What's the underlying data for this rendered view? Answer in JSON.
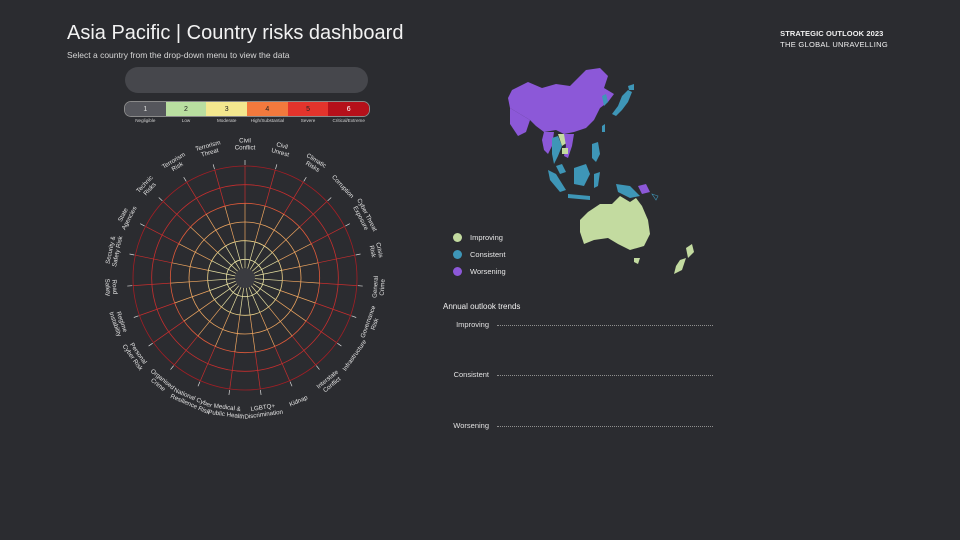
{
  "header": {
    "title": "Asia Pacific | Country risks dashboard",
    "subtitle": "Select a country from the drop-down menu to view the data",
    "brand_line1": "STRATEGIC OUTLOOK 2023",
    "brand_line2": "THE GLOBAL UNRAVELLING"
  },
  "dropdown": {
    "value": ""
  },
  "risk_scale": [
    {
      "num": "1",
      "label": "Negligible",
      "color": "#55565c"
    },
    {
      "num": "2",
      "label": "Low",
      "color": "#b9dea0"
    },
    {
      "num": "3",
      "label": "Moderate",
      "color": "#f3e78e"
    },
    {
      "num": "4",
      "label": "High/Substantial",
      "color": "#f2793d"
    },
    {
      "num": "5",
      "label": "Severe",
      "color": "#e3342c"
    },
    {
      "num": "6",
      "label": "Critical/Extreme",
      "color": "#b5101a"
    }
  ],
  "radar": {
    "categories": [
      "Civil\nConflict",
      "Civil\nUnrest",
      "Climatic\nRisks",
      "Corruption",
      "Cyber Threat\nExposure",
      "Crisis\nRisk",
      "General\nCrime",
      "Governance\nRisk",
      "Infrastructure",
      "Interstate\nConflict",
      "Kidnap",
      "LGBTQ+\nDiscrimination",
      "Medical &\nPublic Health",
      "National Cyber\nResilience Risk",
      "Organised\nCrime",
      "Personal\nCyber Risk",
      "Regime\nInstability",
      "Road\nSafety",
      "Security &\nSafety Risk",
      "State\nAgencies",
      "Technic\nRisks",
      "Terrorism\nRisk",
      "Terrorism\nThreat"
    ],
    "ring_colors": [
      "#e7e0a2",
      "#eed48a",
      "#eda560",
      "#df5a3a",
      "#c72e2e",
      "#a41e25"
    ]
  },
  "map_legend": [
    {
      "label": "Improving",
      "color": "#c3dba0"
    },
    {
      "label": "Consistent",
      "color": "#3e96b7"
    },
    {
      "label": "Worsening",
      "color": "#8c58d8"
    }
  ],
  "trends": {
    "title": "Annual outlook trends",
    "rows": [
      "Improving",
      "Consistent",
      "Worsening"
    ]
  }
}
